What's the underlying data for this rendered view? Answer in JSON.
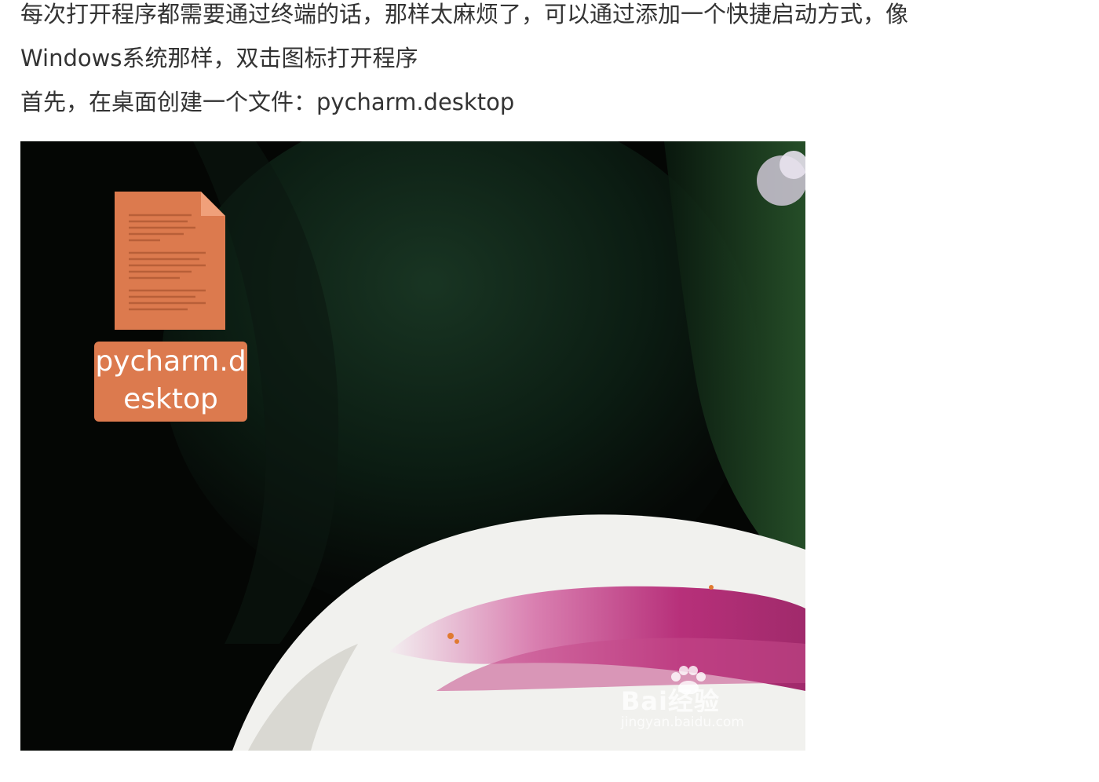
{
  "article": {
    "paragraph_1": "每次打开程序都需要通过终端的话，那样太麻烦了，可以通过添加一个快捷启动方式，像",
    "paragraph_1_cont": "Windows系统那样，双击图标打开程序",
    "paragraph_2": "首先，在桌面创建一个文件：pycharm.desktop"
  },
  "screenshot": {
    "file_icon_label": "pycharm.desktop",
    "watermark_brand": "Bai经验",
    "watermark_url": "jingyan.baidu.com"
  },
  "colors": {
    "text": "#333333",
    "file_icon": "#dc7a4e",
    "desktop_bg": "#050806"
  },
  "icons": [
    "text-file-icon",
    "baidu-paw-icon"
  ]
}
